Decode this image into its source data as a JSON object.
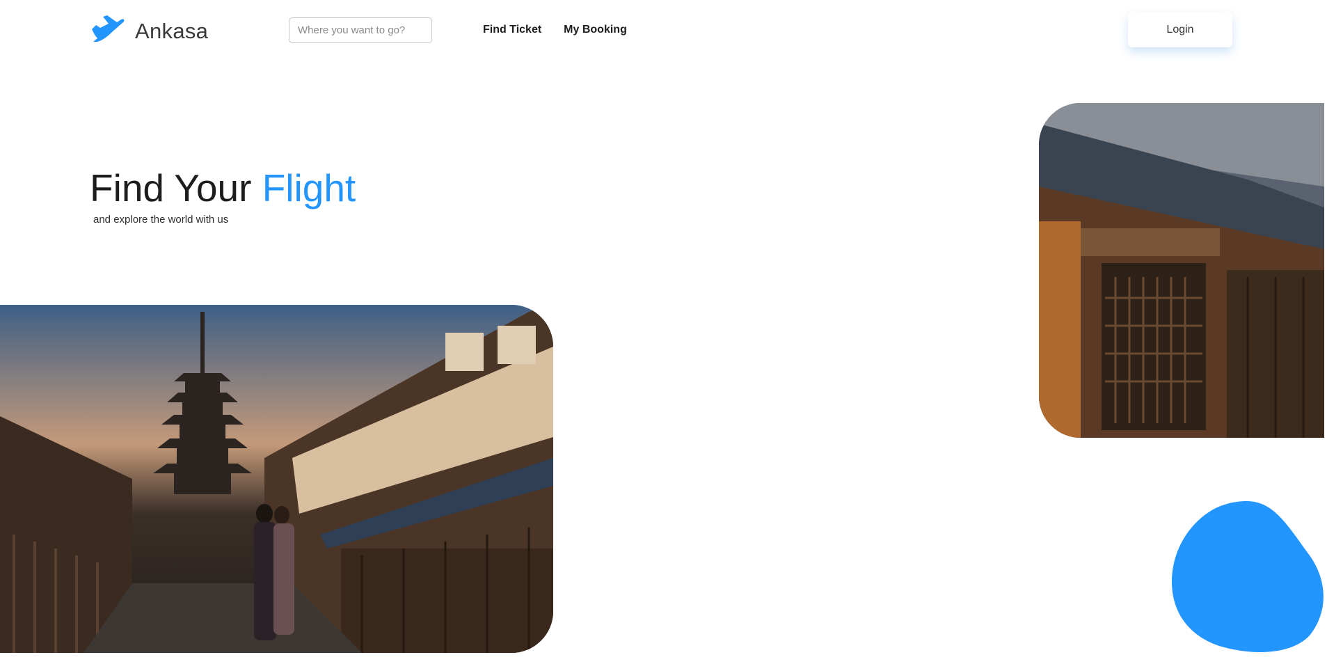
{
  "brand": {
    "name": "Ankasa",
    "logo_icon": "plane-icon",
    "color": "#2395ff"
  },
  "search": {
    "placeholder": "Where you want to go?",
    "value": ""
  },
  "nav": {
    "items": [
      {
        "label": "Find Ticket"
      },
      {
        "label": "My Booking"
      }
    ]
  },
  "login": {
    "label": "Login"
  },
  "hero": {
    "title_main": "Find Your ",
    "title_accent": "Flight",
    "subtitle": "and explore the world with us"
  },
  "images": {
    "left": "kyoto-street-pagoda-photo",
    "right": "kyoto-wooden-house-photo"
  },
  "colors": {
    "accent": "#2395ff",
    "text": "#1d1d1d"
  }
}
